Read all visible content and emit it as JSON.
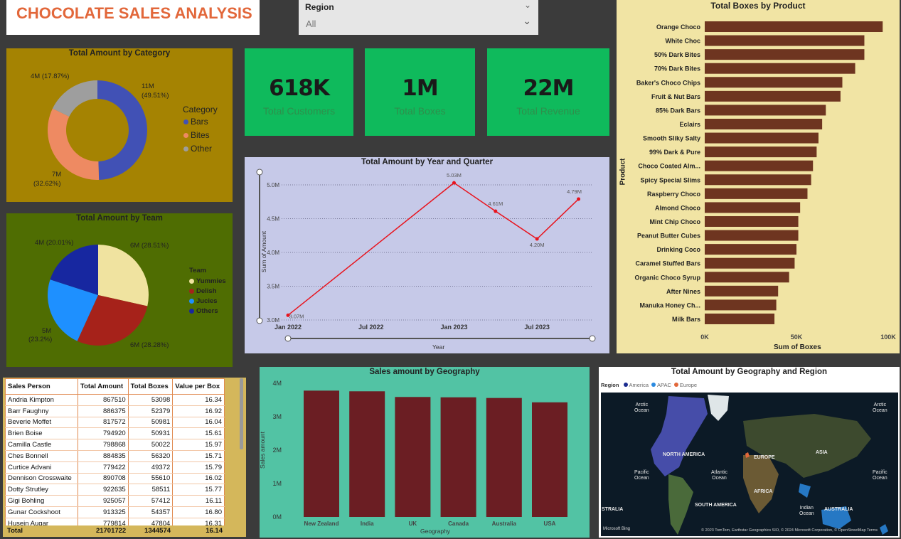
{
  "header": {
    "title": "CHOCOLATE SALES ANALYSIS"
  },
  "slicer": {
    "label": "Region",
    "value": "All"
  },
  "kpis": [
    {
      "value": "618K",
      "label": "Total Customers"
    },
    {
      "value": "1M",
      "label": "Total Boxes"
    },
    {
      "value": "22M",
      "label": "Total Revenue"
    }
  ],
  "category_chart": {
    "title": "Total Amount by Category",
    "legend_title": "Category",
    "labels": {
      "bars_val": "11M",
      "bars_pct": "(49.51%)",
      "bites_val": "7M",
      "bites_pct": "(32.62%)",
      "other": "4M (17.87%)"
    }
  },
  "team_chart": {
    "title": "Total Amount by Team",
    "legend_title": "Team",
    "labels": {
      "yummies": "6M (28.51%)",
      "delish": "6M (28.28%)",
      "jucies_val": "5M",
      "jucies_pct": "(23.2%)",
      "others": "4M (20.01%)"
    }
  },
  "line_chart": {
    "title": "Total Amount by Year and Quarter",
    "xlabel": "Year",
    "ylabel": "Sum of Amount"
  },
  "boxes_chart": {
    "title": "Total Boxes by Product",
    "xlabel": "Sum of Boxes",
    "ylabel": "Product"
  },
  "geo_chart": {
    "title": "Sales amount by Geography",
    "xlabel": "Geography",
    "ylabel": "Sales amount"
  },
  "map": {
    "title": "Total Amount by Geography and Region",
    "legend_label": "Region",
    "legend": [
      {
        "name": "America",
        "color": "#1a2b8f"
      },
      {
        "name": "APAC",
        "color": "#2b8ae0"
      },
      {
        "name": "Europe",
        "color": "#e2673a"
      }
    ],
    "labels": [
      {
        "id": "arctic1",
        "text": "Arctic\nOcean"
      },
      {
        "id": "arctic2",
        "text": "Arctic\nOcean"
      },
      {
        "id": "namerica",
        "text": "NORTH AMERICA"
      },
      {
        "id": "europe",
        "text": "EUROPE"
      },
      {
        "id": "asia",
        "text": "ASIA"
      },
      {
        "id": "pac1",
        "text": "Pacific\nOcean"
      },
      {
        "id": "atl",
        "text": "Atlantic\nOcean"
      },
      {
        "id": "pac2",
        "text": "Pacific\nOcean"
      },
      {
        "id": "africa",
        "text": "AFRICA"
      },
      {
        "id": "samerica",
        "text": "SOUTH AMERICA"
      },
      {
        "id": "indian",
        "text": "Indian\nOcean"
      },
      {
        "id": "australia",
        "text": "AUSTRALIA"
      },
      {
        "id": "stralia",
        "text": "STRALIA"
      }
    ],
    "attribution": "© 2023 TomTom, Earthstar Geographics SIO, © 2024 Microsoft Corporation, © OpenStreetMap  Terms",
    "bing": "Microsoft Bing"
  },
  "table": {
    "headers": [
      "Sales Person",
      "Total Amount",
      "Total Boxes",
      "Value per Box"
    ],
    "rows": [
      [
        "Andria Kimpton",
        "867510",
        "53098",
        "16.34"
      ],
      [
        "Barr Faughny",
        "886375",
        "52379",
        "16.92"
      ],
      [
        "Beverie Moffet",
        "817572",
        "50981",
        "16.04"
      ],
      [
        "Brien Boise",
        "794920",
        "50931",
        "15.61"
      ],
      [
        "Camilla Castle",
        "798868",
        "50022",
        "15.97"
      ],
      [
        "Ches Bonnell",
        "884835",
        "56320",
        "15.71"
      ],
      [
        "Curtice Advani",
        "779422",
        "49372",
        "15.79"
      ],
      [
        "Dennison Crosswaite",
        "890708",
        "55610",
        "16.02"
      ],
      [
        "Dotty Strutley",
        "922635",
        "58511",
        "15.77"
      ],
      [
        "Gigi Bohling",
        "925057",
        "57412",
        "16.11"
      ],
      [
        "Gunar Cockshoot",
        "913325",
        "54357",
        "16.80"
      ],
      [
        "Husein Augar",
        "779814",
        "47804",
        "16.31"
      ]
    ],
    "total": [
      "Total",
      "21701722",
      "1344574",
      "16.14"
    ]
  },
  "chart_data": [
    {
      "type": "pie",
      "title": "Total Amount by Category",
      "categories": [
        "Bars",
        "Bites",
        "Other"
      ],
      "values": [
        49.51,
        32.62,
        17.87
      ],
      "colors": [
        "#4151b5",
        "#ee8a62",
        "#9e9e9e"
      ],
      "legend": "right"
    },
    {
      "type": "pie",
      "title": "Total Amount by Team",
      "categories": [
        "Yummies",
        "Delish",
        "Jucies",
        "Others"
      ],
      "values": [
        28.51,
        28.28,
        23.2,
        20.01
      ],
      "colors": [
        "#f0e3a0",
        "#a6221a",
        "#1e90ff",
        "#1727a0"
      ],
      "legend": "right"
    },
    {
      "type": "line",
      "title": "Total Amount by Year and Quarter",
      "x": [
        "Jan 2022",
        "Jan 2023",
        "Apr 2023",
        "Jul 2023",
        "Oct 2023"
      ],
      "values": [
        3.07,
        5.03,
        4.61,
        4.2,
        4.79
      ],
      "point_labels": [
        "3.07M",
        "5.03M",
        "4.61M",
        "4.20M",
        "4.79M"
      ],
      "x_ticks": [
        "Jan 2022",
        "Jul 2022",
        "Jan 2023",
        "Jul 2023"
      ],
      "y_ticks": [
        "3.0M",
        "3.5M",
        "4.0M",
        "4.5M",
        "5.0M"
      ],
      "ylim": [
        3.0,
        5.2
      ],
      "xlabel": "Year",
      "ylabel": "Sum of Amount",
      "color": "#e8141e"
    },
    {
      "type": "bar",
      "orientation": "horizontal",
      "title": "Total Boxes by Product",
      "categories": [
        "Orange Choco",
        "White Choc",
        "50% Dark Bites",
        "70% Dark Bites",
        "Baker's Choco Chips",
        "Fruit & Nut Bars",
        "85% Dark Bars",
        "Eclairs",
        "Smooth Sliky Salty",
        "99% Dark & Pure",
        "Choco Coated Alm...",
        "Spicy Special Slims",
        "Raspberry Choco",
        "Almond Choco",
        "Mint Chip Choco",
        "Peanut Butter Cubes",
        "Drinking Coco",
        "Caramel Stuffed Bars",
        "Organic Choco Syrup",
        "After Nines",
        "Manuka Honey Ch...",
        "Milk Bars"
      ],
      "values": [
        97000,
        87000,
        87000,
        82000,
        75000,
        74000,
        66000,
        64000,
        62000,
        61000,
        59000,
        58000,
        56000,
        52000,
        51000,
        51000,
        50000,
        49000,
        46000,
        40000,
        39000,
        38000
      ],
      "x_ticks": [
        "0K",
        "50K",
        "100K"
      ],
      "xlim": [
        0,
        100000
      ],
      "xlabel": "Sum of Boxes",
      "ylabel": "Product",
      "color": "#6e3520"
    },
    {
      "type": "bar",
      "title": "Sales amount by Geography",
      "categories": [
        "New Zealand",
        "India",
        "UK",
        "Canada",
        "Australia",
        "USA"
      ],
      "values": [
        3.78,
        3.76,
        3.59,
        3.58,
        3.56,
        3.43
      ],
      "y_ticks": [
        "0M",
        "1M",
        "2M",
        "3M",
        "4M"
      ],
      "ylim": [
        0,
        4
      ],
      "xlabel": "Geography",
      "ylabel": "Sales amount",
      "color": "#6b1e23"
    }
  ]
}
